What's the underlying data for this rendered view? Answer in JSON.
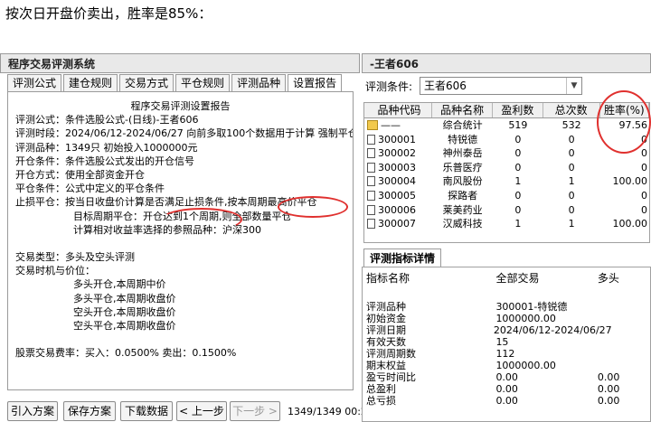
{
  "caption": "按次日开盘价卖出，胜率是85%：",
  "left": {
    "title": "程序交易评测系统",
    "tabs": [
      "评测公式",
      "建仓规则",
      "交易方式",
      "平仓规则",
      "评测品种",
      "设置报告"
    ],
    "report_lines": [
      "评测公式：条件选股公式-(日线)-王者606",
      "评测时段：2024/06/12-2024/06/27 向前多取100个数据用于计算 强制平仓",
      "评测品种：1349只 初始投入1000000元",
      "开仓条件：条件选股公式发出的开仓信号",
      "开仓方式：使用全部资金开仓",
      "平仓条件：公式中定义的平仓条件",
      "止损平仓：按当日收盘价计算是否满足止损条件,按本周期最高价平仓",
      "目标周期平仓：开仓达到1个周期,则全部数量平仓",
      "计算相对收益率选择的参照品种：沪深300",
      "交易类型：多头及空头评测",
      "交易时机与价位：",
      "多头开仓,本周期中价",
      "多头平仓,本周期收盘价",
      "空头开仓,本周期收盘价",
      "空头平仓,本周期收盘价",
      "股票交易费率：买入：0.0500%  卖出：0.1500%"
    ],
    "report_heading": "程序交易评测设置报告",
    "buttons": {
      "import": "引入方案",
      "save": "保存方案",
      "download": "下载数据",
      "prev": "< 上一步",
      "next": "下一步 >"
    },
    "count": "1349/1349 00:2"
  },
  "right": {
    "title": "-王者606",
    "cond_label": "评测条件:",
    "cond_value": "王者606",
    "grid_headers": [
      "品种代码",
      "品种名称",
      "盈利数",
      "总次数",
      "胜率(%)"
    ],
    "grid_rows": [
      {
        "code": "——",
        "name": "综合统计",
        "wins": "519",
        "total": "532",
        "rate": "97.56",
        "folder": true
      },
      {
        "code": "300001",
        "name": "特锐德",
        "wins": "0",
        "total": "0",
        "rate": "0"
      },
      {
        "code": "300002",
        "name": "神州泰岳",
        "wins": "0",
        "total": "0",
        "rate": "0"
      },
      {
        "code": "300003",
        "name": "乐普医疗",
        "wins": "0",
        "total": "0",
        "rate": "0"
      },
      {
        "code": "300004",
        "name": "南风股份",
        "wins": "1",
        "total": "1",
        "rate": "100.00"
      },
      {
        "code": "300005",
        "name": "探路者",
        "wins": "0",
        "total": "0",
        "rate": "0"
      },
      {
        "code": "300006",
        "name": "莱美药业",
        "wins": "0",
        "total": "0",
        "rate": "0"
      },
      {
        "code": "300007",
        "name": "汉威科技",
        "wins": "1",
        "total": "1",
        "rate": "100.00"
      }
    ],
    "detail_tab": "评测指标详情",
    "detail_headers": [
      "指标名称",
      "全部交易",
      "多头"
    ],
    "detail_rows": [
      {
        "name": "评测品种",
        "all": "300001-特锐德",
        "long": ""
      },
      {
        "name": "初始资金",
        "all": "1000000.00",
        "long": ""
      },
      {
        "name": "评测日期",
        "all": "2024/06/12-2024/06/27",
        "long": ""
      },
      {
        "name": "有效天数",
        "all": "15",
        "long": ""
      },
      {
        "name": "评测周期数",
        "all": "112",
        "long": ""
      },
      {
        "name": "期末权益",
        "all": "1000000.00",
        "long": ""
      },
      {
        "name": "盈亏时间比",
        "all": "0.00",
        "long": "0.00"
      },
      {
        "name": "总盈利",
        "all": "0.00",
        "long": "0.00"
      },
      {
        "name": "总亏损",
        "all": "0.00",
        "long": "0.00"
      }
    ]
  }
}
